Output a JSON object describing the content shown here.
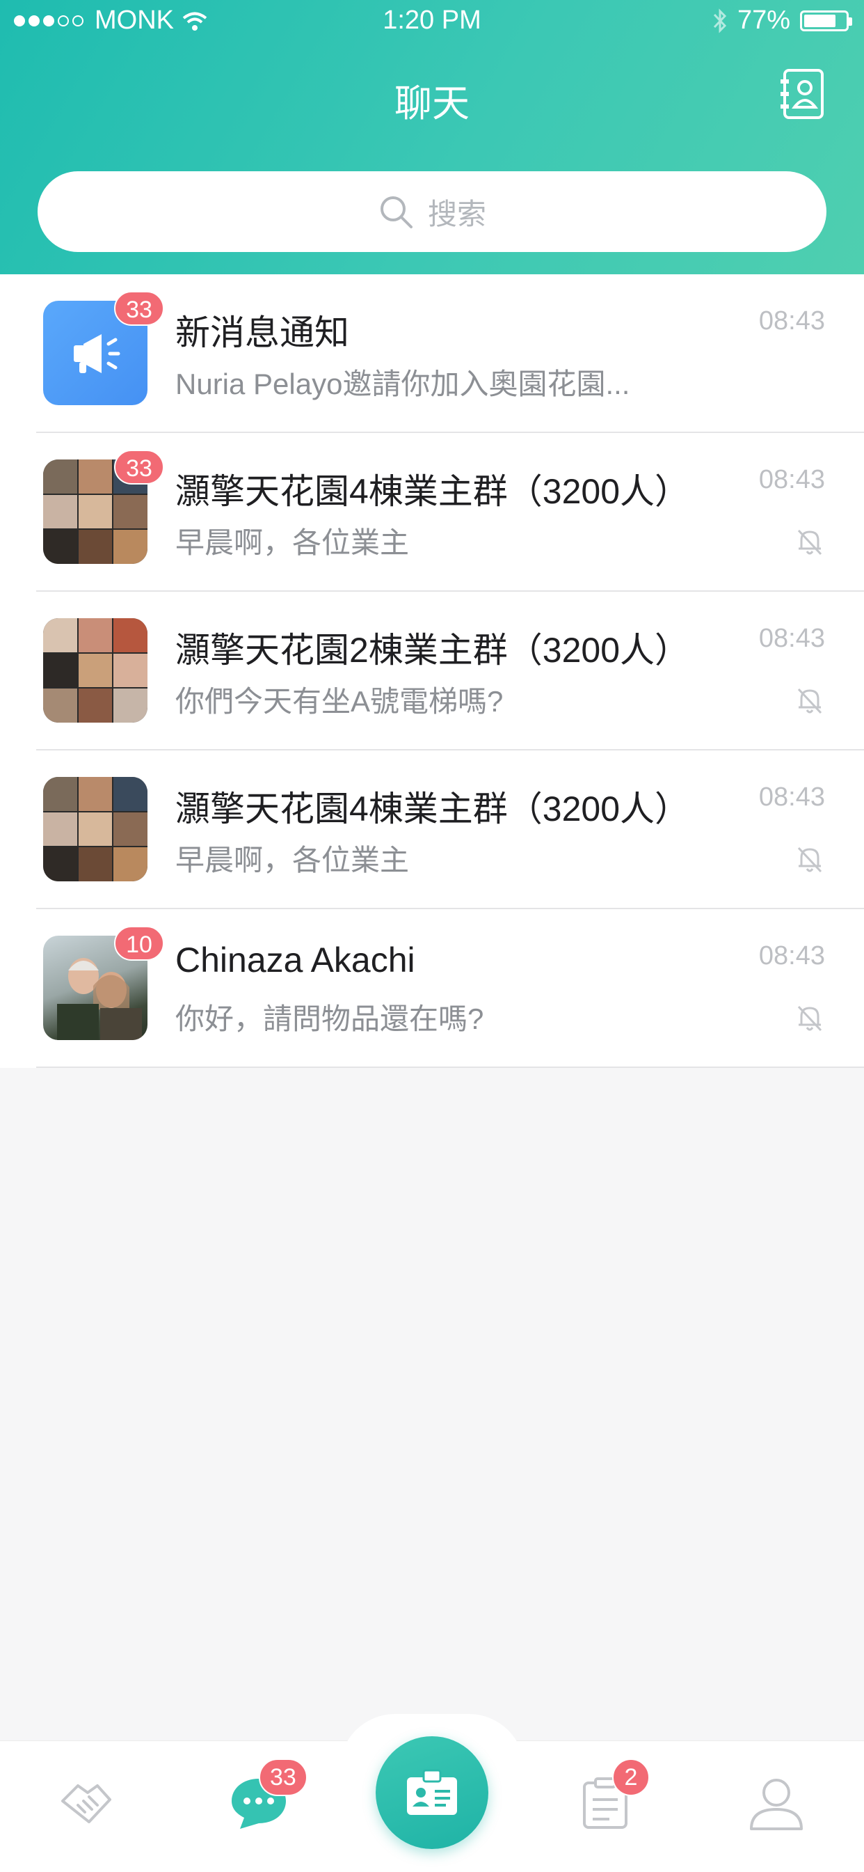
{
  "status_bar": {
    "carrier": "MONK",
    "time": "1:20 PM",
    "battery": "77%",
    "battery_level": 0.77
  },
  "header": {
    "title": "聊天",
    "search_placeholder": "搜索",
    "contacts_icon": "contacts-book-icon"
  },
  "chats": [
    {
      "name": "新消息通知",
      "preview": "Nuria Pelayo邀請你加入奧園花園...",
      "time": "08:43",
      "badge": "33",
      "muted": false,
      "avatar": "megaphone-icon"
    },
    {
      "name": "灝擎天花園4棟業主群（3200人）",
      "preview": "早晨啊，各位業主",
      "time": "08:43",
      "badge": "33",
      "muted": true,
      "avatar": "group-photo-grid"
    },
    {
      "name": "灝擎天花園2棟業主群（3200人）",
      "preview": "你們今天有坐A號電梯嗎?",
      "time": "08:43",
      "badge": "",
      "muted": true,
      "avatar": "group-photo-grid"
    },
    {
      "name": "灝擎天花園4棟業主群（3200人）",
      "preview": "早晨啊，各位業主",
      "time": "08:43",
      "badge": "",
      "muted": true,
      "avatar": "group-photo-grid"
    },
    {
      "name": "Chinaza Akachi",
      "preview": "你好，請問物品還在嗎?",
      "time": "08:43",
      "badge": "10",
      "muted": true,
      "avatar": "user-photo"
    }
  ],
  "tabbar": {
    "chat_badge": "33",
    "notice_badge": "2",
    "tabs": [
      "handshake-icon",
      "chat-bubble-icon",
      "id-card-icon",
      "clipboard-icon",
      "person-icon"
    ]
  },
  "colors": {
    "accent": "#35c3b2",
    "badge": "#f26a74",
    "notice_blue": "#4d9cf7"
  }
}
